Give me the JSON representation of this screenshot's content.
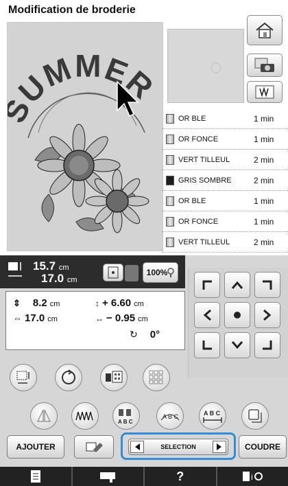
{
  "header": {
    "title": "Modification de broderie"
  },
  "preview": {
    "text": "SUMMER"
  },
  "threads": [
    {
      "name": "OR BLE",
      "time": "1 min",
      "dark": false
    },
    {
      "name": "OR FONCE",
      "time": "1 min",
      "dark": false
    },
    {
      "name": "VERT TILLEUL",
      "time": "2 min",
      "dark": false
    },
    {
      "name": "GRIS SOMBRE",
      "time": "2 min",
      "dark": true
    },
    {
      "name": "OR BLE",
      "time": "1 min",
      "dark": false
    },
    {
      "name": "OR FONCE",
      "time": "1 min",
      "dark": false
    },
    {
      "name": "VERT TILLEUL",
      "time": "2 min",
      "dark": false
    }
  ],
  "size": {
    "height": "15.7",
    "width": "17.0",
    "unit": "cm",
    "zoom": "100%"
  },
  "position": {
    "vertical": "8.2",
    "horizontal": "17.0",
    "unit": "cm",
    "offset_vertical": "+ 6.60",
    "offset_horizontal": "− 0.95",
    "rotation": "0°"
  },
  "buttons": {
    "ajouter": "AJOUTER",
    "coudre": "COUDRE",
    "selection": "SELECTION",
    "abc": "A B C",
    "abc2": "A B C"
  },
  "colors": {
    "accent": "#2e8fd8",
    "dark_bar": "#2c2c2c",
    "panel": "#d3d3d3"
  }
}
